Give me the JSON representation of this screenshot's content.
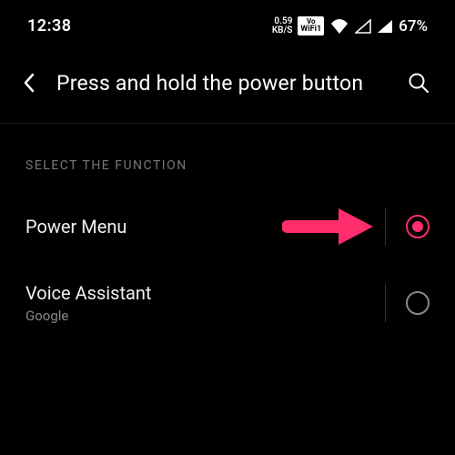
{
  "status": {
    "time": "12:38",
    "net_speed_value": "0.59",
    "net_speed_unit": "KB/S",
    "vowifi_top": "Vo",
    "vowifi_bottom": "WiFi1",
    "battery": "67%"
  },
  "header": {
    "title": "Press and hold the power button"
  },
  "section": {
    "label": "SELECT THE FUNCTION"
  },
  "options": [
    {
      "title": "Power Menu",
      "sub": "",
      "selected": true
    },
    {
      "title": "Voice Assistant",
      "sub": "Google",
      "selected": false
    }
  ],
  "colors": {
    "accent": "#ff2d6b"
  }
}
